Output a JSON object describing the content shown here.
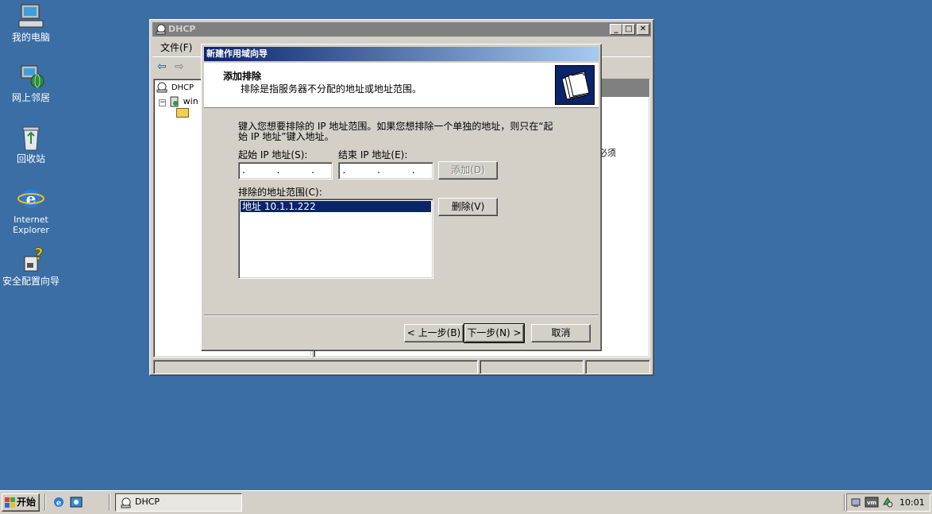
{
  "desktop": {
    "icons": [
      {
        "label": "我的电脑"
      },
      {
        "label": "网上邻居"
      },
      {
        "label": "回收站"
      },
      {
        "label": "Internet Explorer"
      },
      {
        "label": "安全配置向导"
      }
    ]
  },
  "dhcp_window": {
    "title": "DHCP",
    "menu": [
      "文件(F)"
    ],
    "tree": {
      "root": "DHCP",
      "server": "win"
    },
    "right_pane_partial_text": "必须"
  },
  "wizard": {
    "title": "新建作用域向导",
    "header_title": "添加排除",
    "header_subtitle": "排除是指服务器不分配的地址或地址范围。",
    "instruction_line1": "键入您想要排除的 IP 地址范围。如果您想排除一个单独的地址，则只在“起",
    "instruction_line2": "始 IP 地址”键入地址。",
    "start_ip_label": "起始 IP 地址(S):",
    "end_ip_label": "结束 IP 地址(E):",
    "start_ip_value": ". . .",
    "end_ip_value": ". . .",
    "add_button": "添加(D)",
    "excluded_label": "排除的地址范围(C):",
    "excluded_items": [
      "地址 10.1.1.222"
    ],
    "remove_button": "删除(V)",
    "back_button": "< 上一步(B)",
    "next_button": "下一步(N) >",
    "cancel_button": "取消"
  },
  "taskbar": {
    "start_label": "开始",
    "task_label": "DHCP",
    "clock": "10:01"
  }
}
